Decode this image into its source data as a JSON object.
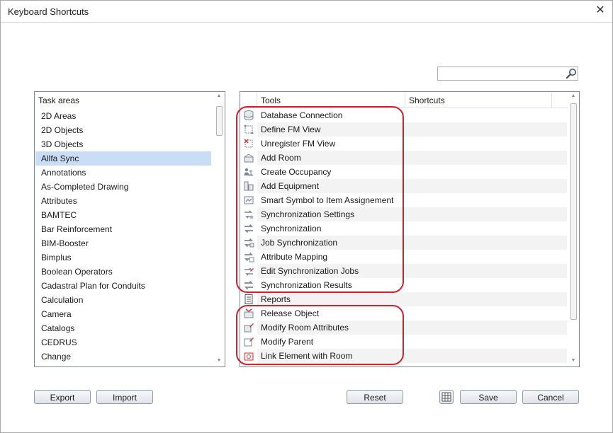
{
  "window": {
    "title": "Keyboard Shortcuts",
    "close_glyph": "✕"
  },
  "search": {
    "value": "",
    "placeholder": "",
    "icon": "magnifier-icon"
  },
  "task_areas": {
    "header": "Task areas",
    "items": [
      {
        "label": "2D Areas"
      },
      {
        "label": "2D Objects"
      },
      {
        "label": "3D Objects"
      },
      {
        "label": "Allfa Sync",
        "selected": true
      },
      {
        "label": "Annotations"
      },
      {
        "label": "As-Completed Drawing"
      },
      {
        "label": "Attributes"
      },
      {
        "label": "BAMTEC"
      },
      {
        "label": "Bar Reinforcement"
      },
      {
        "label": "BIM-Booster"
      },
      {
        "label": "Bimplus"
      },
      {
        "label": "Boolean Operators"
      },
      {
        "label": "Cadastral Plan for Conduits"
      },
      {
        "label": "Calculation"
      },
      {
        "label": "Camera"
      },
      {
        "label": "Catalogs"
      },
      {
        "label": "CEDRUS"
      },
      {
        "label": "Change"
      }
    ]
  },
  "tools_table": {
    "columns": {
      "tools": "Tools",
      "shortcuts": "Shortcuts"
    },
    "rows": [
      {
        "tool": "Database Connection",
        "shortcut": "",
        "icon": "database-icon"
      },
      {
        "tool": "Define FM View",
        "shortcut": "",
        "icon": "fm-view-icon"
      },
      {
        "tool": "Unregister FM View",
        "shortcut": "",
        "icon": "unregister-view-icon"
      },
      {
        "tool": "Add Room",
        "shortcut": "",
        "icon": "add-room-icon"
      },
      {
        "tool": "Create Occupancy",
        "shortcut": "",
        "icon": "occupancy-icon"
      },
      {
        "tool": "Add Equipment",
        "shortcut": "",
        "icon": "equipment-icon"
      },
      {
        "tool": "Smart Symbol to Item Assignement",
        "shortcut": "",
        "icon": "smart-symbol-icon"
      },
      {
        "tool": "Synchronization Settings",
        "shortcut": "",
        "icon": "sync-settings-icon"
      },
      {
        "tool": "Synchronization",
        "shortcut": "",
        "icon": "sync-icon"
      },
      {
        "tool": "Job Synchronization",
        "shortcut": "",
        "icon": "job-sync-icon"
      },
      {
        "tool": "Attribute Mapping",
        "shortcut": "",
        "icon": "attribute-mapping-icon"
      },
      {
        "tool": "Edit Synchronization Jobs",
        "shortcut": "",
        "icon": "edit-sync-jobs-icon"
      },
      {
        "tool": "Synchronization Results",
        "shortcut": "",
        "icon": "sync-results-icon"
      },
      {
        "tool": "Reports",
        "shortcut": "",
        "icon": "reports-icon"
      },
      {
        "tool": "Release Object",
        "shortcut": "",
        "icon": "release-object-icon"
      },
      {
        "tool": "Modify Room Attributes",
        "shortcut": "",
        "icon": "modify-room-attributes-icon"
      },
      {
        "tool": "Modify Parent",
        "shortcut": "",
        "icon": "modify-parent-icon"
      },
      {
        "tool": "Link Element with Room",
        "shortcut": "",
        "icon": "link-element-icon"
      }
    ]
  },
  "buttons": {
    "export": "Export",
    "import": "Import",
    "reset": "Reset",
    "save": "Save",
    "cancel": "Cancel",
    "grid_icon": "table-grid-icon"
  },
  "colors": {
    "selection": "#c9def5",
    "highlight_ring": "#d0212c",
    "alt_row": "#f3f3f3"
  }
}
